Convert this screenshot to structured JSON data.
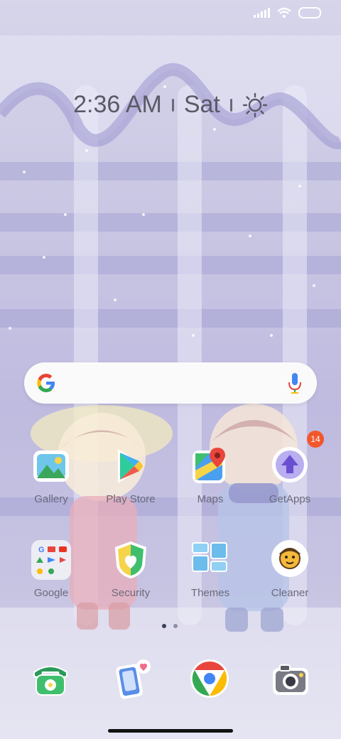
{
  "status_bar": {
    "signal_icon": "signal-icon",
    "wifi_icon": "wifi-icon",
    "battery_icon": "battery-icon"
  },
  "clock": {
    "time": "2:36 AM",
    "day": "Sat",
    "weather_icon": "sun-icon"
  },
  "search_bar": {
    "logo_icon": "google-g-icon",
    "mic_icon": "mic-icon"
  },
  "apps": [
    {
      "label": "Gallery",
      "icon": "gallery-icon"
    },
    {
      "label": "Play Store",
      "icon": "play-store-icon"
    },
    {
      "label": "Maps",
      "icon": "maps-icon"
    },
    {
      "label": "GetApps",
      "icon": "getapps-icon",
      "badge": "14"
    },
    {
      "label": "Google",
      "icon": "google-folder-icon"
    },
    {
      "label": "Security",
      "icon": "security-icon"
    },
    {
      "label": "Themes",
      "icon": "themes-icon"
    },
    {
      "label": "Cleaner",
      "icon": "cleaner-icon"
    }
  ],
  "page_indicator": {
    "pages": 2,
    "current": 1
  },
  "dock": [
    {
      "icon": "phone-icon"
    },
    {
      "icon": "messages-icon"
    },
    {
      "icon": "chrome-icon"
    },
    {
      "icon": "camera-icon"
    }
  ],
  "colors": {
    "wallpaper": "#c9c6e3",
    "label_text": "#6a6a7a",
    "clock_text": "#5a5966",
    "badge": "#f2572c"
  }
}
